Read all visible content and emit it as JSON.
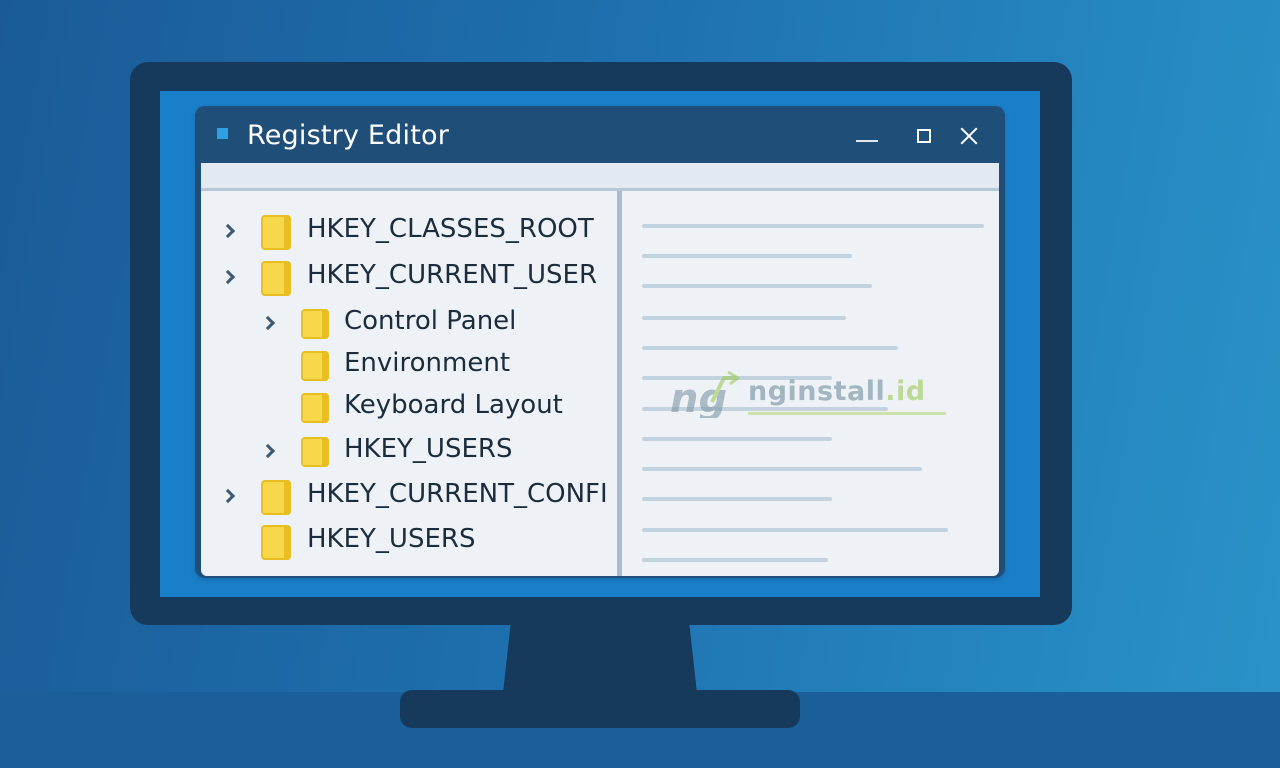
{
  "window": {
    "title": "Registry Editor"
  },
  "tree": {
    "items": [
      {
        "label": "HKEY_CLASSES_ROOT",
        "level": 0,
        "expandable": true
      },
      {
        "label": "HKEY_CURRENT_USER",
        "level": 0,
        "expandable": true
      },
      {
        "label": "Control Panel",
        "level": 1,
        "expandable": true
      },
      {
        "label": "Environment",
        "level": 1,
        "expandable": false
      },
      {
        "label": "Keyboard Layout",
        "level": 1,
        "expandable": false
      },
      {
        "label": "HKEY_USERS",
        "level": 1,
        "expandable": true
      },
      {
        "label": "HKEY_CURRENT_CONFI",
        "level": 0,
        "expandable": true
      },
      {
        "label": "HKEY_USERS",
        "level": 0,
        "expandable": false
      }
    ]
  },
  "watermark": {
    "logo_text": "ng",
    "site_name": "nginstall",
    "site_tld": ".id"
  },
  "icons": {
    "app": "registry-app-icon",
    "minimize": "minimize-icon",
    "maximize": "maximize-icon",
    "close": "close-icon",
    "expand": "chevron-right-icon",
    "key": "folder-icon"
  },
  "colors": {
    "background": "#1e70ae",
    "monitor_bezel": "#173a5c",
    "screen": "#1a7fc9",
    "titlebar": "#1f4e79",
    "client": "#eef2f6",
    "folder": "#f6d84a",
    "text": "#1b2c3d"
  }
}
